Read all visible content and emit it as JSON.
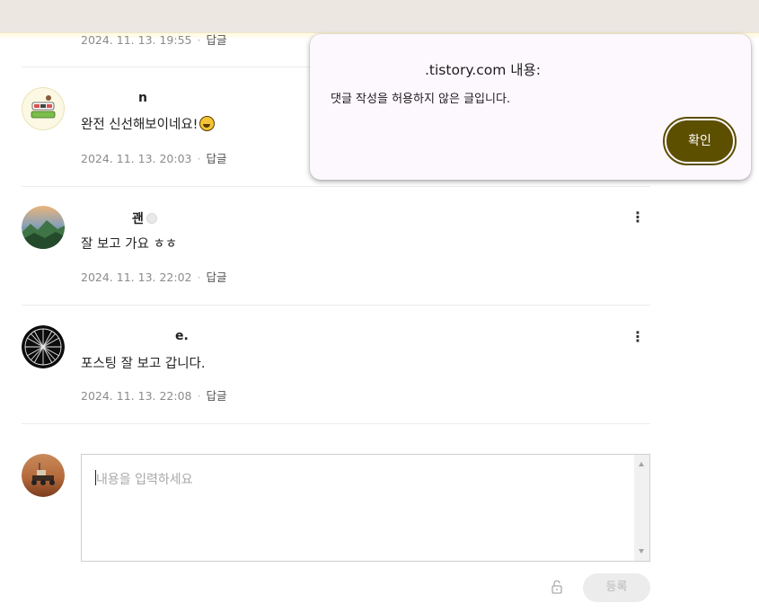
{
  "comments": [
    {
      "author": "",
      "text": "",
      "date": "2024. 11. 13. 19:55",
      "reply_label": "답글"
    },
    {
      "author": "n",
      "text": "완전 신선해보이네요!",
      "date": "2024. 11. 13. 20:03",
      "reply_label": "답글"
    },
    {
      "author": "괜",
      "text": "잘 보고 가요 ㅎㅎ",
      "date": "2024. 11. 13. 22:02",
      "reply_label": "답글"
    },
    {
      "author": "e.",
      "text": "포스팅 잘 보고 갑니다.",
      "date": "2024. 11. 13. 22:08",
      "reply_label": "답글"
    }
  ],
  "compose": {
    "placeholder": "내용을 입력하세요",
    "submit_label": "등록"
  },
  "dialog": {
    "title": ".tistory.com 내용:",
    "message": "댓글 작성을 허용하지 않은 글입니다.",
    "ok_label": "확인"
  },
  "colors": {
    "accent": "#5d4f00",
    "dialog_bg": "#fdf8fd",
    "topbar_bg": "#ece7e0"
  }
}
